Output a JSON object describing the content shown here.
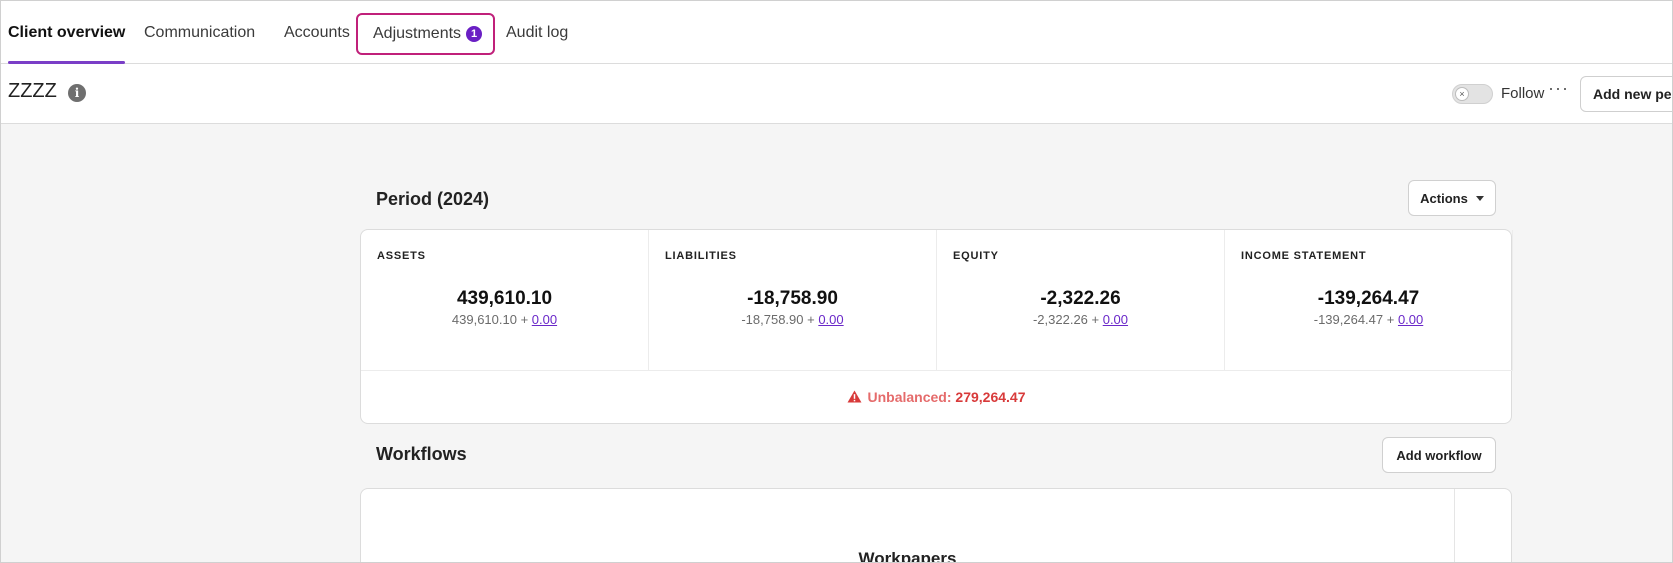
{
  "tabs": [
    {
      "label": "Client overview",
      "active": true
    },
    {
      "label": "Communication",
      "active": false
    },
    {
      "label": "Accounts",
      "active": false
    },
    {
      "label": "Adjustments",
      "active": false,
      "badge": "1"
    },
    {
      "label": "Audit log",
      "active": false
    }
  ],
  "header": {
    "client_name": "ZZZZ",
    "info_icon": "info-icon",
    "toggle_icon": "×",
    "follow_label": "Follow",
    "more_icon": "···",
    "add_period_label": "Add new period"
  },
  "period": {
    "title": "Period (2024)",
    "actions_label": "Actions",
    "stats": [
      {
        "label": "ASSETS",
        "value": "439,610.10",
        "sub_base": "439,610.10 + ",
        "sub_link": "0.00"
      },
      {
        "label": "LIABILITIES",
        "value": "-18,758.90",
        "sub_base": "-18,758.90 + ",
        "sub_link": "0.00"
      },
      {
        "label": "EQUITY",
        "value": "-2,322.26",
        "sub_base": "-2,322.26 + ",
        "sub_link": "0.00"
      },
      {
        "label": "INCOME STATEMENT",
        "value": "-139,264.47",
        "sub_base": "-139,264.47 + ",
        "sub_link": "0.00"
      }
    ],
    "unbalanced_label": "Unbalanced:",
    "unbalanced_value": "279,264.47"
  },
  "workflows": {
    "title": "Workflows",
    "add_label": "Add workflow",
    "workpapers_title": "Workpapers"
  },
  "colors": {
    "accent": "#7a3ec7",
    "badge": "#6a1fc4",
    "highlight_border": "#c0207a",
    "warning": "#d83a3a"
  }
}
